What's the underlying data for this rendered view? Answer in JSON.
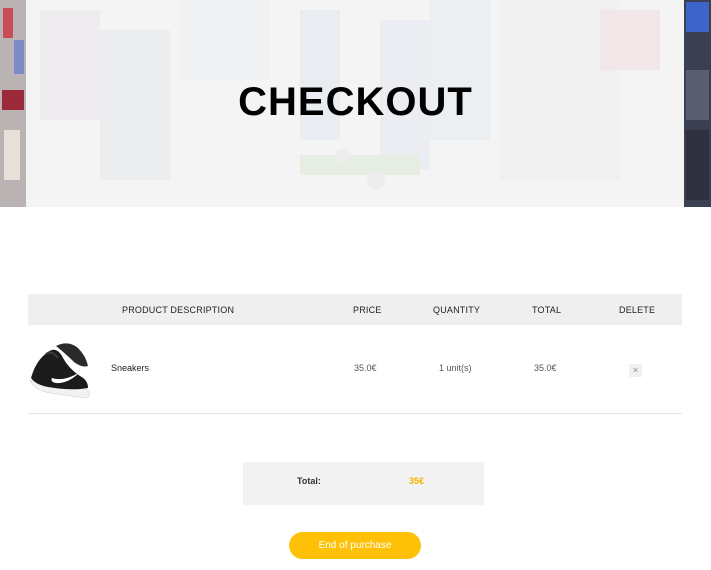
{
  "hero": {
    "title": "CHECKOUT"
  },
  "cart": {
    "columns": {
      "description": "PRODUCT DESCRIPTION",
      "price": "PRICE",
      "quantity": "QUANTITY",
      "total": "TOTAL",
      "delete": "DELETE"
    },
    "items": [
      {
        "name": "Sneakers",
        "price": "35.0€",
        "quantity": "1 unit(s)",
        "total": "35.0€",
        "delete_icon": "×",
        "image_icon": "sneaker-image"
      }
    ]
  },
  "summary": {
    "label": "Total:",
    "value": "35€",
    "value_color": "#f5b400"
  },
  "actions": {
    "end_purchase": "End of purchase",
    "button_color": "#fec107"
  }
}
